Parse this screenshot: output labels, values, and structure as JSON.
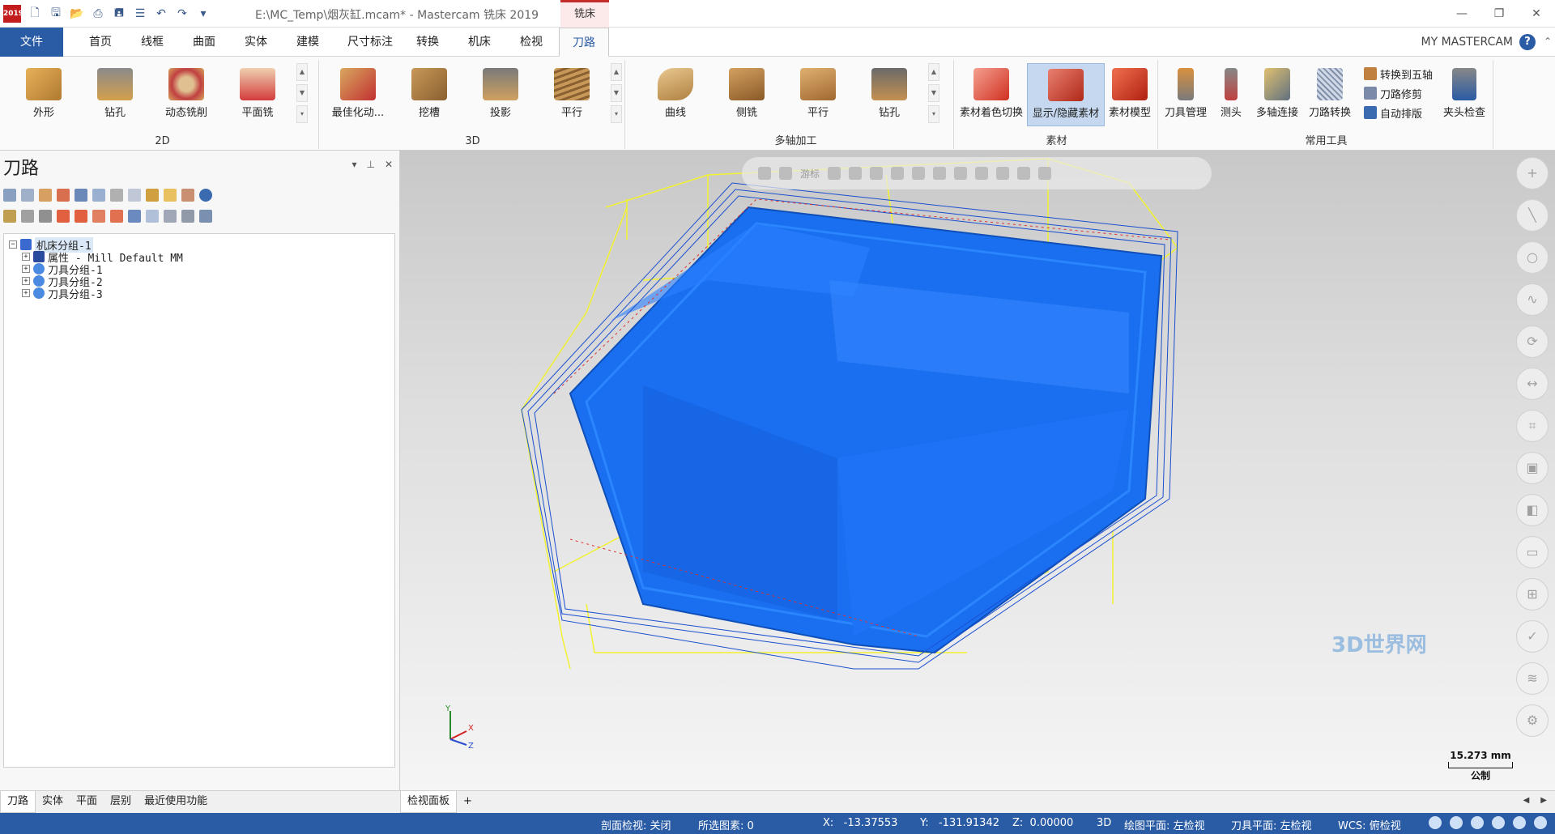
{
  "titlebar": {
    "logo": "2019",
    "title": "E:\\MC_Temp\\烟灰缸.mcam* - Mastercam 铣床 2019",
    "context_tab": "铣床",
    "minimize": "—",
    "restore": "❐",
    "close": "✕"
  },
  "menu": {
    "tabs": [
      "文件",
      "首页",
      "线框",
      "曲面",
      "实体",
      "建模",
      "尺寸标注",
      "转换",
      "机床",
      "检视",
      "刀路"
    ],
    "active": "刀路",
    "my_mastercam": "MY MASTERCAM"
  },
  "ribbon": {
    "group_2d": {
      "label": "2D",
      "buttons": [
        "外形",
        "钻孔",
        "动态铣削",
        "平面铣"
      ]
    },
    "group_3d": {
      "label": "3D",
      "buttons": [
        "最佳化动...",
        "挖槽",
        "投影",
        "平行"
      ]
    },
    "group_multi": {
      "label": "多轴加工",
      "buttons": [
        "曲线",
        "侧铣",
        "平行",
        "钻孔"
      ]
    },
    "group_stock": {
      "label": "素材",
      "buttons": [
        "素材着色切换",
        "显示/隐藏素材",
        "素材模型"
      ]
    },
    "group_util": {
      "label": "常用工具",
      "buttons": [
        "刀具管理",
        "测头",
        "多轴连接",
        "刀路转换"
      ],
      "small": [
        "转换到五轴",
        "刀路修剪",
        "自动排版"
      ],
      "extra": "夹头检查"
    }
  },
  "panel": {
    "title": "刀路",
    "pin": "↓ ⭳",
    "tree": {
      "root": "机床分组-1",
      "children": [
        "属性 - Mill Default MM",
        "刀具分组-1",
        "刀具分组-2",
        "刀具分组-3"
      ]
    },
    "bottom_tabs": [
      "刀路",
      "实体",
      "平面",
      "层别",
      "最近使用功能"
    ]
  },
  "viewport": {
    "viewbar_label": "游标",
    "scale_value": "15.273 mm",
    "scale_unit": "公制",
    "axes": {
      "x": "X",
      "y": "Y",
      "z": "Z"
    },
    "tabs": [
      "检视面板",
      "+"
    ],
    "watermark": "3D世界网"
  },
  "status": {
    "section_view": "剖面检视: 关闭",
    "selected": "所选图素: 0",
    "x": "X:   -13.37553",
    "y": "Y:   -131.91342",
    "z": "Z:  0.00000",
    "mode": "3D",
    "draw_plane": "绘图平面: 左检视",
    "tool_plane": "刀具平面: 左检视",
    "wcs": "WCS: 俯检视"
  },
  "colors": {
    "accent": "#2a5ba5",
    "part_blue": "#1a6ff0",
    "toolpath_yellow": "#f2f230",
    "toolpath_blue": "#1a4fd0"
  }
}
